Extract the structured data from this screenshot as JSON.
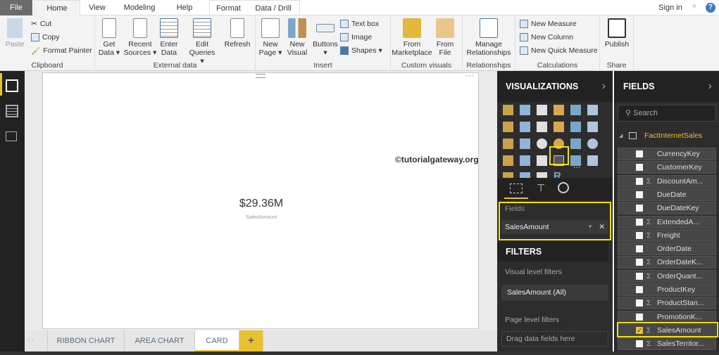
{
  "tabs": [
    {
      "label": "File"
    },
    {
      "label": "Home"
    },
    {
      "label": "View"
    },
    {
      "label": "Modeling"
    },
    {
      "label": "Help"
    },
    {
      "label": "Format"
    },
    {
      "label": "Data / Drill"
    }
  ],
  "sign_in": "Sign in",
  "ribbon": {
    "clipboard": {
      "label": "Clipboard",
      "paste": "Paste",
      "cut": "Cut",
      "copy": "Copy",
      "format_painter": "Format Painter"
    },
    "external": {
      "label": "External data",
      "get_data": [
        "Get",
        "Data ▾"
      ],
      "recent": [
        "Recent",
        "Sources ▾"
      ],
      "enter": [
        "Enter",
        "Data"
      ],
      "edit": [
        "Edit",
        "Queries ▾"
      ],
      "refresh": "Refresh"
    },
    "insert": {
      "label": "Insert",
      "new_page": [
        "New",
        "Page ▾"
      ],
      "new_visual": [
        "New",
        "Visual"
      ],
      "buttons": [
        "Buttons",
        "▾"
      ],
      "text_box": "Text box",
      "image": "Image",
      "shapes": "Shapes ▾"
    },
    "custom": {
      "label": "Custom visuals",
      "marketplace": [
        "From",
        "Marketplace"
      ],
      "file": [
        "From",
        "File"
      ]
    },
    "relationships": {
      "label": "Relationships",
      "manage": [
        "Manage",
        "Relationships"
      ]
    },
    "calculations": {
      "label": "Calculations",
      "new_measure": "New Measure",
      "new_column": "New Column",
      "new_quick": "New Quick Measure"
    },
    "share": {
      "label": "Share",
      "publish": "Publish"
    }
  },
  "card": {
    "value": "$29.36M",
    "label": "SalesAmount"
  },
  "watermark": "©tutorialgateway.org",
  "page_tabs": [
    {
      "label": "RIBBON CHART"
    },
    {
      "label": "AREA CHART"
    },
    {
      "label": "CARD"
    }
  ],
  "add_page": "+",
  "visualizations": {
    "title": "VISUALIZATIONS",
    "fields_label": "Fields",
    "field_value": "SalesAmount",
    "filters_title": "FILTERS",
    "visual_filters": "Visual level filters",
    "visual_filter_item": "SalesAmount (All)",
    "page_filters": "Page level filters",
    "drag_here": "Drag data fields here",
    "more": "...",
    "r": "R"
  },
  "fields": {
    "title": "FIELDS",
    "search_placeholder": "Search",
    "table": "FactInternetSales",
    "items": [
      {
        "name": "CurrencyKey",
        "sigma": "",
        "checked": false
      },
      {
        "name": "CustomerKey",
        "sigma": "",
        "checked": false
      },
      {
        "name": "DiscountAm...",
        "sigma": "Σ",
        "checked": false
      },
      {
        "name": "DueDate",
        "sigma": "",
        "checked": false
      },
      {
        "name": "DueDateKey",
        "sigma": "",
        "checked": false
      },
      {
        "name": "ExtendedA...",
        "sigma": "Σ",
        "checked": false
      },
      {
        "name": "Freight",
        "sigma": "Σ",
        "checked": false
      },
      {
        "name": "OrderDate",
        "sigma": "",
        "checked": false
      },
      {
        "name": "OrderDateK...",
        "sigma": "Σ",
        "checked": false
      },
      {
        "name": "OrderQuant...",
        "sigma": "Σ",
        "checked": false
      },
      {
        "name": "ProductKey",
        "sigma": "",
        "checked": false
      },
      {
        "name": "ProductStan...",
        "sigma": "Σ",
        "checked": false
      },
      {
        "name": "PromotionK...",
        "sigma": "",
        "checked": false
      },
      {
        "name": "SalesAmount",
        "sigma": "Σ",
        "checked": true
      },
      {
        "name": "SalesTerritor...",
        "sigma": "Σ",
        "checked": false
      }
    ]
  },
  "colors": {
    "accent": "#e8c130",
    "highlight": "#f2e200",
    "dark": "#2d2d2d"
  }
}
